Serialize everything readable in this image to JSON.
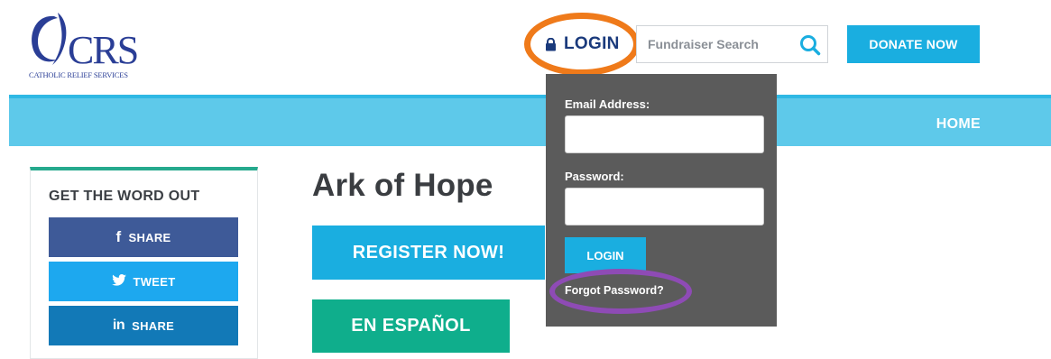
{
  "logo": {
    "wordmark": "CRS",
    "tagline": "CATHOLIC RELIEF SERVICES"
  },
  "header": {
    "login_label": "LOGIN",
    "search_placeholder": "Fundraiser Search",
    "donate_label": "DONATE NOW"
  },
  "nav": {
    "home_label": "HOME"
  },
  "sidebar": {
    "title": "GET THE WORD OUT",
    "facebook_label": "SHARE",
    "twitter_label": "TWEET",
    "linkedin_label": "SHARE",
    "linkedin_glyph": "in"
  },
  "main": {
    "title": "Ark of Hope",
    "register_label": "REGISTER NOW!",
    "espanol_label": "EN ESPAÑOL"
  },
  "login_panel": {
    "email_label": "Email Address:",
    "email_value": "",
    "password_label": "Password:",
    "password_value": "",
    "login_button_label": "LOGIN",
    "forgot_label": "Forgot Password?"
  },
  "colors": {
    "brand_blue": "#2a3e96",
    "accent_cyan": "#1aaee0",
    "nav_bar": "#5ec9ea",
    "green": "#0fae8c",
    "facebook": "#3e5a98",
    "twitter": "#1da8ef",
    "linkedin": "#1279b7",
    "panel_gray": "#5b5b5b",
    "highlight_orange": "#ef7a1a",
    "highlight_purple": "#8e4bb5"
  },
  "icons": {
    "login": "lock-icon",
    "search": "search-icon",
    "facebook": "facebook-icon",
    "twitter": "twitter-icon",
    "linkedin": "linkedin-icon"
  }
}
